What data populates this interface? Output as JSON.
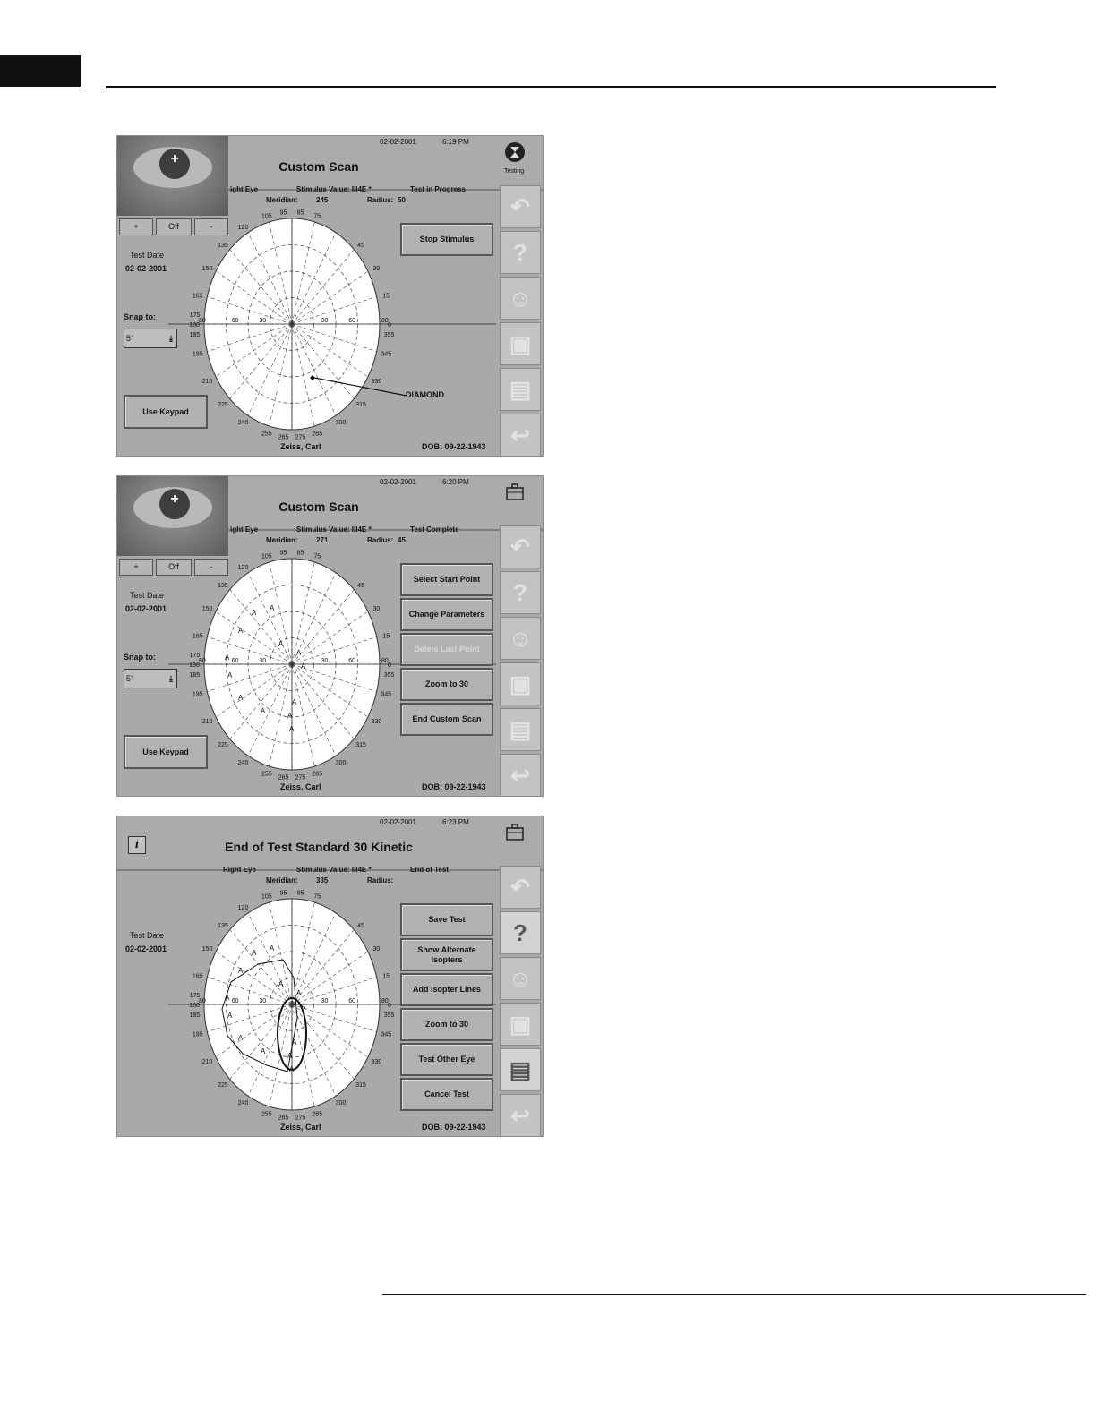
{
  "screens": [
    {
      "title": "Custom Scan",
      "date": "02-02-2001",
      "time": "6:19 PM",
      "status_label": "Testing",
      "eye": "ight Eye",
      "stimulus": "Stimulus Value: III4E *",
      "state": "Test in Progress",
      "meridian_label": "Meridian:",
      "meridian_value": "245",
      "radius_label": "Radius:",
      "radius_value": "50",
      "eye_buttons": [
        "+",
        "Off",
        "-"
      ],
      "test_date_label": "Test Date",
      "test_date": "02-02-2001",
      "snap_label": "Snap to:",
      "snap_value": "5°",
      "keypad_label": "Use Keypad",
      "buttons": [
        "Stop Stimulus"
      ],
      "callout": "DIAMOND",
      "patient": "Zeiss, Carl",
      "dob": "DOB: 09-22-1943"
    },
    {
      "title": "Custom Scan",
      "date": "02-02-2001",
      "time": "6:20 PM",
      "eye": "ight Eye",
      "stimulus": "Stimulus Value: III4E *",
      "state": "Test Complete",
      "meridian_label": "Meridian:",
      "meridian_value": "271",
      "radius_label": "Radius:",
      "radius_value": "45",
      "eye_buttons": [
        "+",
        "Off",
        "-"
      ],
      "test_date_label": "Test Date",
      "test_date": "02-02-2001",
      "snap_label": "Snap to:",
      "snap_value": "5°",
      "keypad_label": "Use Keypad",
      "buttons": [
        "Select Start Point",
        "Change Parameters",
        "Delete Last Point",
        "Zoom to 30",
        "End Custom Scan"
      ],
      "patient": "Zeiss, Carl",
      "dob": "DOB: 09-22-1943"
    },
    {
      "title": "End of Test Standard 30 Kinetic",
      "date": "02-02-2001",
      "time": "6:23 PM",
      "info_icon": "i",
      "eye": "Right Eye",
      "stimulus": "Stimulus Value: III4E *",
      "state": "End of Test",
      "meridian_label": "Meridian:",
      "meridian_value": "335",
      "radius_label": "Radius:",
      "test_date_label": "Test Date",
      "test_date": "02-02-2001",
      "buttons": [
        "Save Test",
        "Show Alternate Isopters",
        "Add Isopter Lines",
        "Zoom to 30",
        "Test Other Eye",
        "Cancel Test"
      ],
      "patient": "Zeiss, Carl",
      "dob": "DOB: 09-22-1943"
    }
  ],
  "meridian_labels": [
    "0",
    "15",
    "30",
    "45",
    "75",
    "85",
    "95",
    "105",
    "120",
    "135",
    "150",
    "165",
    "175",
    "180",
    "185",
    "195",
    "210",
    "225",
    "240",
    "255",
    "265",
    "275",
    "285",
    "300",
    "315",
    "330",
    "345",
    "355"
  ],
  "radius_labels": [
    "30",
    "60",
    "80"
  ],
  "rail_icons": [
    "back-arrow-icon",
    "help-icon",
    "head-icon",
    "disk-icon",
    "printer-icon",
    "return-arrow-icon"
  ],
  "colors": {
    "screen_bg": "#a9a9a9",
    "grid_bg": "#ffffff",
    "ink": "#111111"
  }
}
